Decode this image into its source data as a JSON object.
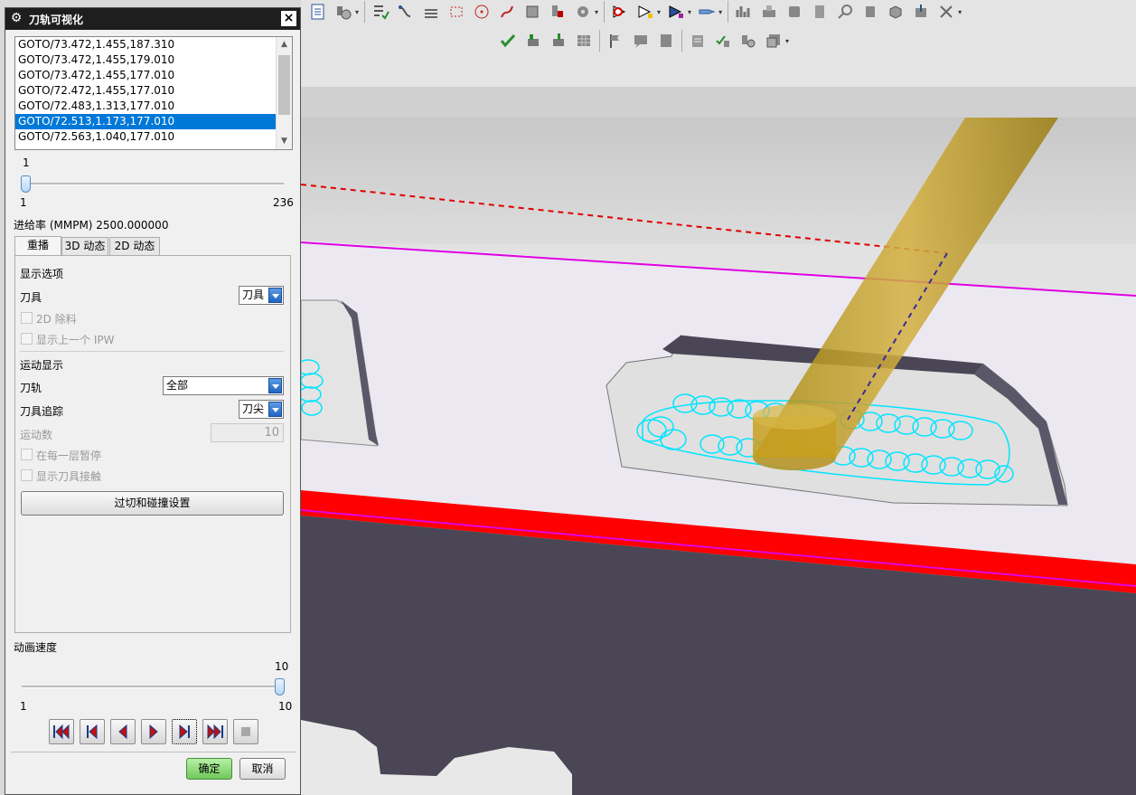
{
  "dialog": {
    "title": "刀轨可视化",
    "close": "×",
    "gcode_lines": [
      "GOTO/73.472,1.455,187.310",
      "GOTO/73.472,1.455,179.010",
      "GOTO/73.472,1.455,177.010",
      "GOTO/72.472,1.455,177.010",
      "GOTO/72.483,1.313,177.010",
      "GOTO/72.513,1.173,177.010",
      "GOTO/72.563,1.040,177.010"
    ],
    "selected_line_index": 5,
    "step_slider": {
      "value": "1",
      "min": "1",
      "max": "236"
    },
    "feed_rate": "进给率 (MMPM) 2500.000000",
    "tabs": [
      "重播",
      "3D 动态",
      "2D 动态"
    ],
    "active_tab": 0,
    "display_options": {
      "section": "显示选项",
      "tool_label": "刀具",
      "tool_value": "刀具",
      "remove_2d": "2D 除料",
      "show_prev_ipw": "显示上一个 IPW"
    },
    "motion_display": {
      "section": "运动显示",
      "path_label": "刀轨",
      "path_value": "全部",
      "trace_label": "刀具追踪",
      "trace_value": "刀尖",
      "motion_count_label": "运动数",
      "motion_count_value": "10",
      "pause_each_layer": "在每一层暂停",
      "show_tool_contact": "显示刀具接触"
    },
    "gouge_button": "过切和碰撞设置",
    "anim_speed": {
      "label": "动画速度",
      "value": "10",
      "min": "1",
      "max": "10"
    },
    "playback_buttons": [
      "rewind-start",
      "step-back",
      "play-reverse",
      "play-forward",
      "step-forward",
      "fast-forward",
      "stop"
    ],
    "ok": "确定",
    "cancel": "取消"
  },
  "colors": {
    "selection": "#0078d7",
    "tool_yellow": "#c8a020",
    "path_cyan": "#00e5ff",
    "magenta": "#e000e0",
    "red_band": "#ff0000",
    "dark_body": "#4a4656",
    "floor": "#ebe8f2"
  }
}
